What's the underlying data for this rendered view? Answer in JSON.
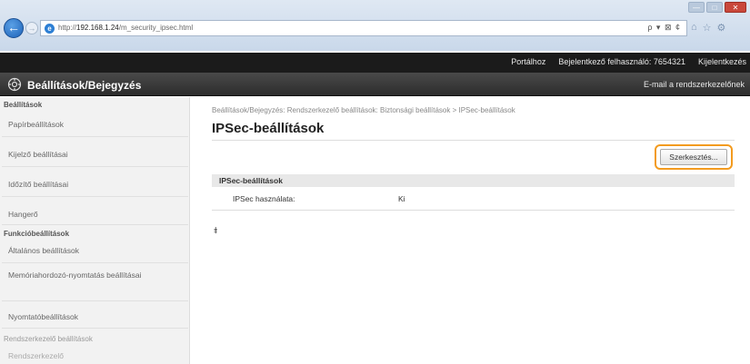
{
  "browser": {
    "url_prefix": "http://",
    "url_host": "192.168.1.24",
    "url_path": "/m_security_ipsec.html",
    "address_tools": "ρ ▾ ⊠ ¢",
    "window_buttons": [
      "—",
      "□",
      "✕"
    ]
  },
  "topbar": {
    "portal_link": "Portálhoz",
    "logged_in_label": "Bejelentkező felhasználó:",
    "logged_in_user": "7654321",
    "logout_link": "Kijelentkezés"
  },
  "titlebar": {
    "title": "Beállítások/Bejegyzés",
    "email_link": "E-mail a rendszerkezelőnek"
  },
  "sidebar": {
    "sections": [
      {
        "heading": "Beállítások",
        "items": [
          "Papírbeállítások",
          "Kijelző beállításai",
          "Időzítő beállításai",
          "Hangerő"
        ]
      },
      {
        "heading": "Funkcióbeállítások",
        "items": [
          "Általános beállítások",
          "Memóriahordozó-nyomtatás beállításai",
          "Nyomtatóbeállítások"
        ]
      },
      {
        "heading": "Rendszerkezelő beállítások",
        "items": [
          "Rendszerkezelő"
        ]
      }
    ]
  },
  "main": {
    "breadcrumb": "Beállítások/Bejegyzés: Rendszerkezelő beállítások: Biztonsági beállítások > IPSec-beállítások",
    "title": "IPSec-beállítások",
    "edit_button": "Szerkesztés...",
    "section_heading": "IPSec-beállítások",
    "setting_label": "IPSec használata:",
    "setting_value": "Ki",
    "top_link": "⯒"
  }
}
